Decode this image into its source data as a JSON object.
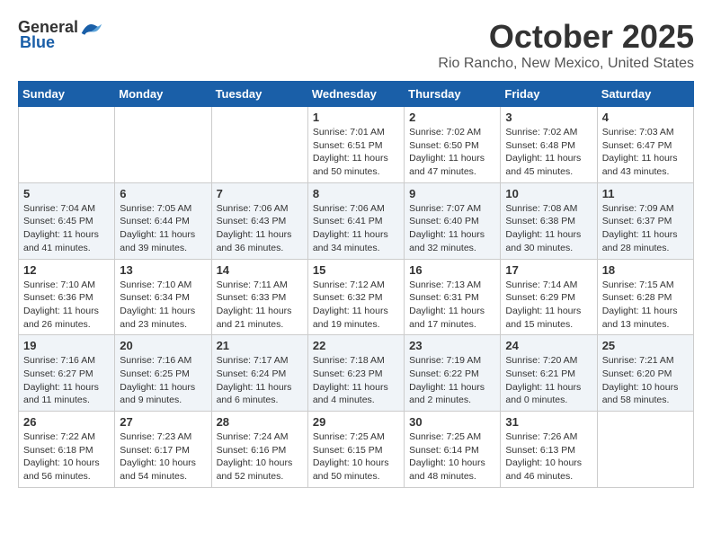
{
  "logo": {
    "general": "General",
    "blue": "Blue"
  },
  "title": "October 2025",
  "location": "Rio Rancho, New Mexico, United States",
  "headers": [
    "Sunday",
    "Monday",
    "Tuesday",
    "Wednesday",
    "Thursday",
    "Friday",
    "Saturday"
  ],
  "weeks": [
    [
      {
        "day": "",
        "info": ""
      },
      {
        "day": "",
        "info": ""
      },
      {
        "day": "",
        "info": ""
      },
      {
        "day": "1",
        "info": "Sunrise: 7:01 AM\nSunset: 6:51 PM\nDaylight: 11 hours\nand 50 minutes."
      },
      {
        "day": "2",
        "info": "Sunrise: 7:02 AM\nSunset: 6:50 PM\nDaylight: 11 hours\nand 47 minutes."
      },
      {
        "day": "3",
        "info": "Sunrise: 7:02 AM\nSunset: 6:48 PM\nDaylight: 11 hours\nand 45 minutes."
      },
      {
        "day": "4",
        "info": "Sunrise: 7:03 AM\nSunset: 6:47 PM\nDaylight: 11 hours\nand 43 minutes."
      }
    ],
    [
      {
        "day": "5",
        "info": "Sunrise: 7:04 AM\nSunset: 6:45 PM\nDaylight: 11 hours\nand 41 minutes."
      },
      {
        "day": "6",
        "info": "Sunrise: 7:05 AM\nSunset: 6:44 PM\nDaylight: 11 hours\nand 39 minutes."
      },
      {
        "day": "7",
        "info": "Sunrise: 7:06 AM\nSunset: 6:43 PM\nDaylight: 11 hours\nand 36 minutes."
      },
      {
        "day": "8",
        "info": "Sunrise: 7:06 AM\nSunset: 6:41 PM\nDaylight: 11 hours\nand 34 minutes."
      },
      {
        "day": "9",
        "info": "Sunrise: 7:07 AM\nSunset: 6:40 PM\nDaylight: 11 hours\nand 32 minutes."
      },
      {
        "day": "10",
        "info": "Sunrise: 7:08 AM\nSunset: 6:38 PM\nDaylight: 11 hours\nand 30 minutes."
      },
      {
        "day": "11",
        "info": "Sunrise: 7:09 AM\nSunset: 6:37 PM\nDaylight: 11 hours\nand 28 minutes."
      }
    ],
    [
      {
        "day": "12",
        "info": "Sunrise: 7:10 AM\nSunset: 6:36 PM\nDaylight: 11 hours\nand 26 minutes."
      },
      {
        "day": "13",
        "info": "Sunrise: 7:10 AM\nSunset: 6:34 PM\nDaylight: 11 hours\nand 23 minutes."
      },
      {
        "day": "14",
        "info": "Sunrise: 7:11 AM\nSunset: 6:33 PM\nDaylight: 11 hours\nand 21 minutes."
      },
      {
        "day": "15",
        "info": "Sunrise: 7:12 AM\nSunset: 6:32 PM\nDaylight: 11 hours\nand 19 minutes."
      },
      {
        "day": "16",
        "info": "Sunrise: 7:13 AM\nSunset: 6:31 PM\nDaylight: 11 hours\nand 17 minutes."
      },
      {
        "day": "17",
        "info": "Sunrise: 7:14 AM\nSunset: 6:29 PM\nDaylight: 11 hours\nand 15 minutes."
      },
      {
        "day": "18",
        "info": "Sunrise: 7:15 AM\nSunset: 6:28 PM\nDaylight: 11 hours\nand 13 minutes."
      }
    ],
    [
      {
        "day": "19",
        "info": "Sunrise: 7:16 AM\nSunset: 6:27 PM\nDaylight: 11 hours\nand 11 minutes."
      },
      {
        "day": "20",
        "info": "Sunrise: 7:16 AM\nSunset: 6:25 PM\nDaylight: 11 hours\nand 9 minutes."
      },
      {
        "day": "21",
        "info": "Sunrise: 7:17 AM\nSunset: 6:24 PM\nDaylight: 11 hours\nand 6 minutes."
      },
      {
        "day": "22",
        "info": "Sunrise: 7:18 AM\nSunset: 6:23 PM\nDaylight: 11 hours\nand 4 minutes."
      },
      {
        "day": "23",
        "info": "Sunrise: 7:19 AM\nSunset: 6:22 PM\nDaylight: 11 hours\nand 2 minutes."
      },
      {
        "day": "24",
        "info": "Sunrise: 7:20 AM\nSunset: 6:21 PM\nDaylight: 11 hours\nand 0 minutes."
      },
      {
        "day": "25",
        "info": "Sunrise: 7:21 AM\nSunset: 6:20 PM\nDaylight: 10 hours\nand 58 minutes."
      }
    ],
    [
      {
        "day": "26",
        "info": "Sunrise: 7:22 AM\nSunset: 6:18 PM\nDaylight: 10 hours\nand 56 minutes."
      },
      {
        "day": "27",
        "info": "Sunrise: 7:23 AM\nSunset: 6:17 PM\nDaylight: 10 hours\nand 54 minutes."
      },
      {
        "day": "28",
        "info": "Sunrise: 7:24 AM\nSunset: 6:16 PM\nDaylight: 10 hours\nand 52 minutes."
      },
      {
        "day": "29",
        "info": "Sunrise: 7:25 AM\nSunset: 6:15 PM\nDaylight: 10 hours\nand 50 minutes."
      },
      {
        "day": "30",
        "info": "Sunrise: 7:25 AM\nSunset: 6:14 PM\nDaylight: 10 hours\nand 48 minutes."
      },
      {
        "day": "31",
        "info": "Sunrise: 7:26 AM\nSunset: 6:13 PM\nDaylight: 10 hours\nand 46 minutes."
      },
      {
        "day": "",
        "info": ""
      }
    ]
  ]
}
